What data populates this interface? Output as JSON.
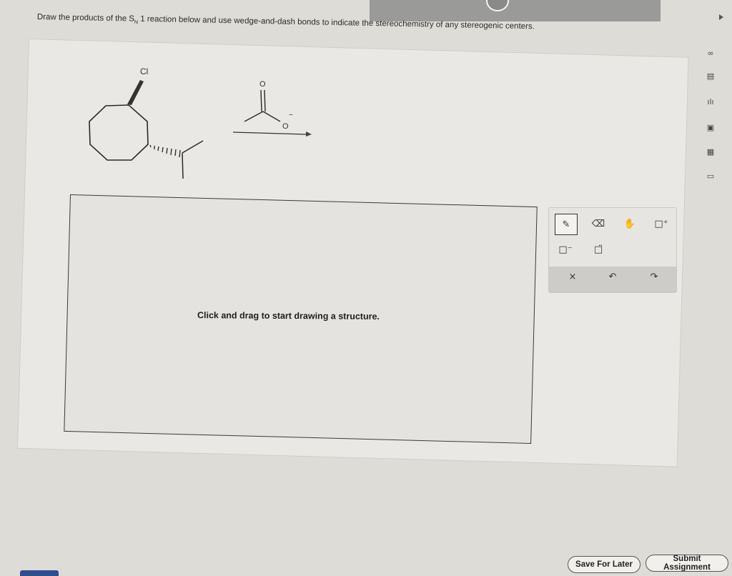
{
  "question": {
    "prefix": "Draw the products of the S",
    "subscript": "N",
    "suffix": "1 reaction below and use wedge-and-dash bonds to indicate the stereochemistry of any stereogenic centers."
  },
  "reaction": {
    "leaving_group_label": "Cl",
    "carbonyl_oxygen_label": "O",
    "anion_oxygen_label": "O",
    "anion_charge": "−"
  },
  "canvas": {
    "hint": "Click and drag to start drawing a structure."
  },
  "toolbar": {
    "tools": [
      {
        "name": "pencil-icon",
        "glyph": "✎",
        "selected": true
      },
      {
        "name": "eraser-icon",
        "glyph": "⌫",
        "selected": false
      },
      {
        "name": "hand-icon",
        "glyph": "✋",
        "selected": false
      },
      {
        "name": "add-positive-charge-icon",
        "glyph": "□⁺",
        "selected": false
      },
      {
        "name": "add-negative-charge-icon",
        "glyph": "□⁻",
        "selected": false
      },
      {
        "name": "lone-pair-icon",
        "glyph": "□̈",
        "selected": false
      }
    ],
    "actions": [
      {
        "name": "clear-icon",
        "glyph": "×"
      },
      {
        "name": "undo-icon",
        "glyph": "↶"
      },
      {
        "name": "redo-icon",
        "glyph": "↷"
      }
    ]
  },
  "sidebar_icons": [
    "infinity-icon",
    "document-icon",
    "chart-icon",
    "image-icon",
    "periodic-table-icon",
    "message-icon"
  ],
  "sidebar_glyphs": [
    "∞",
    "▤",
    "ılı",
    "▣",
    "▦",
    "▭"
  ],
  "footer": {
    "save_label": "Save For Later",
    "submit_label": "Submit Assignment"
  }
}
